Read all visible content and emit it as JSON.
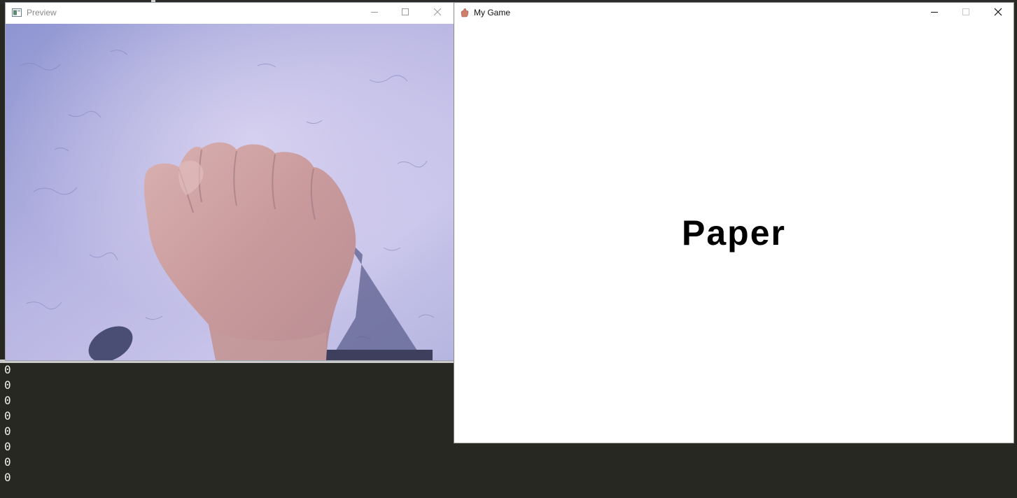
{
  "terminal": {
    "output_lines": [
      "0",
      "0",
      "0",
      "0",
      "0",
      "0",
      "0",
      "0"
    ]
  },
  "preview_window": {
    "title": "Preview",
    "icon": "app-window-icon",
    "camera_feed": "webcam-hand-fist"
  },
  "game_window": {
    "title": "My Game",
    "icon": "hand-icon",
    "result_text": "Paper",
    "background_color": "#ffffff"
  },
  "window_controls": {
    "minimize": "minimize-icon",
    "maximize": "maximize-icon",
    "close": "close-icon"
  }
}
